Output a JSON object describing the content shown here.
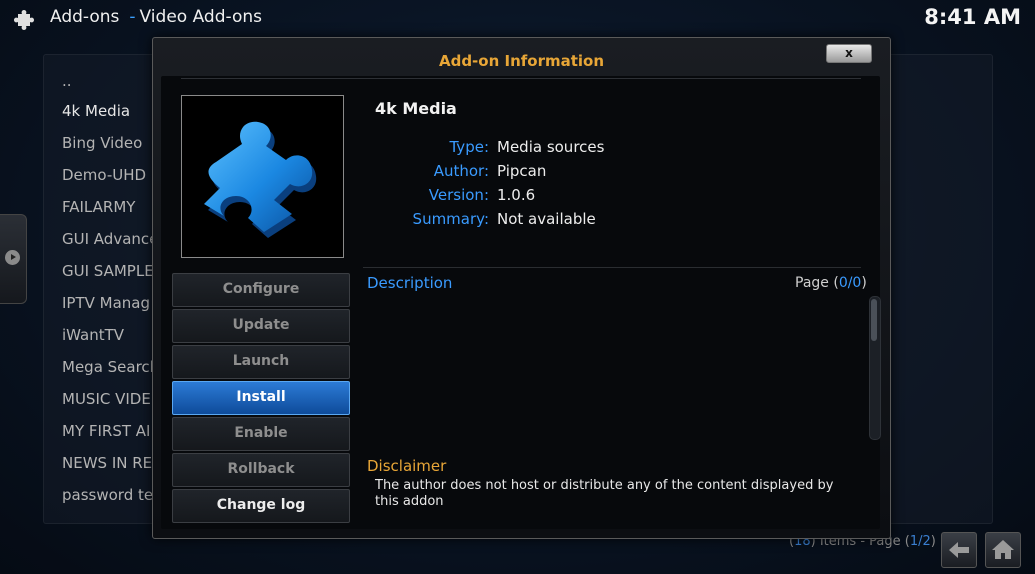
{
  "header": {
    "section": "Add-ons",
    "subsection": "Video Add-ons",
    "separator": "-",
    "clock": "8:41 AM",
    "icon": "puzzle-icon"
  },
  "background_list": {
    "items": [
      "..",
      "4k Media",
      "Bing Video",
      "Demo-UHD",
      "FAILARMY",
      "GUI Advance",
      "GUI SAMPLE",
      "IPTV Manag",
      "iWantTV",
      "Mega Search",
      "MUSIC  VIDE",
      "MY FIRST AI",
      "NEWS IN RE",
      "password te"
    ],
    "selected_index": 1,
    "count_open": "(",
    "count": "18",
    "count_mid": ") Items - Page (",
    "page": "1/2",
    "count_close": ")"
  },
  "dialog": {
    "title": "Add-on Information",
    "close_label": "x",
    "addon_name": "4k Media",
    "fields": [
      {
        "label": "Type:",
        "value": "Media sources"
      },
      {
        "label": "Author:",
        "value": "Pipcan"
      },
      {
        "label": "Version:",
        "value": "1.0.6"
      },
      {
        "label": "Summary:",
        "value": "Not available"
      }
    ],
    "buttons": [
      {
        "label": "Configure",
        "state": "disabled"
      },
      {
        "label": "Update",
        "state": "disabled"
      },
      {
        "label": "Launch",
        "state": "disabled"
      },
      {
        "label": "Install",
        "state": "focused"
      },
      {
        "label": "Enable",
        "state": "disabled"
      },
      {
        "label": "Rollback",
        "state": "disabled"
      },
      {
        "label": "Change log",
        "state": "enabled"
      }
    ],
    "description_label": "Description",
    "page_prefix": "Page (",
    "page_value": "0/0",
    "page_suffix": ")",
    "disclaimer_label": "Disclaimer",
    "disclaimer_text": "The author does not host or distribute any of the content displayed by this addon"
  },
  "colors": {
    "accent_blue": "#3a9bff",
    "title_orange": "#e8a637",
    "focus_blue": "#1f6bc4"
  },
  "nav": {
    "back_icon": "back-arrow-icon",
    "home_icon": "home-icon"
  }
}
